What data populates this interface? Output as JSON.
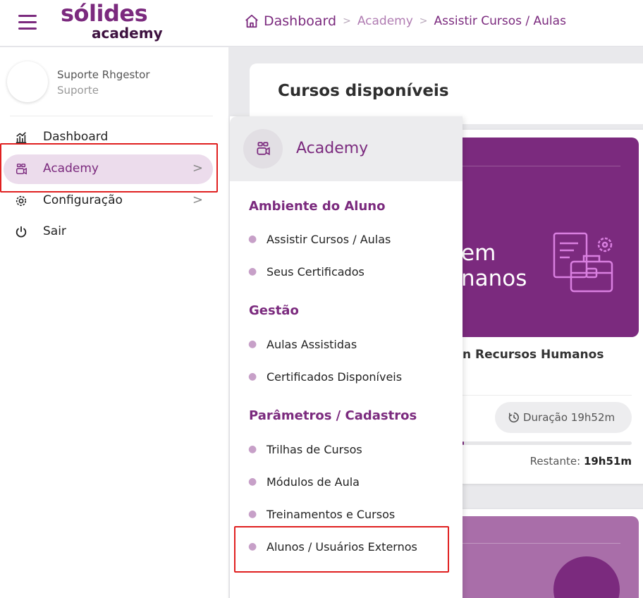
{
  "app": {
    "logo_main": "sólides",
    "logo_sub": "academy"
  },
  "breadcrumb": {
    "items": [
      "Dashboard",
      "Academy",
      "Assistir Cursos / Aulas"
    ]
  },
  "user": {
    "name": "Suporte Rhgestor",
    "role": "Suporte"
  },
  "sidebar": {
    "items": [
      {
        "label": "Dashboard",
        "icon": "chart-icon"
      },
      {
        "label": "Academy",
        "icon": "academy-icon",
        "active": true
      },
      {
        "label": "Configuração",
        "icon": "gear-icon"
      },
      {
        "label": "Sair",
        "icon": "power-icon"
      }
    ]
  },
  "submenu": {
    "title": "Academy",
    "sections": [
      {
        "title": "Ambiente do Aluno",
        "items": [
          "Assistir Cursos / Aulas",
          "Seus Certificados"
        ]
      },
      {
        "title": "Gestão",
        "items": [
          "Aulas Assistidas",
          "Certificados Disponíveis"
        ]
      },
      {
        "title": "Parâmetros / Cadastros",
        "items": [
          "Trilhas de Cursos",
          "Módulos de Aula",
          "Treinamentos e Cursos",
          "Alunos / Usuários Externos"
        ]
      }
    ]
  },
  "main": {
    "title": "Cursos disponíveis",
    "course": {
      "banner_line1": "em",
      "banner_line2": "nanos",
      "name": "n Recursos Humanos",
      "duration": "Duração 19h52m",
      "remaining_label": "Restante:",
      "remaining_value": "19h51m",
      "progress": 0.01
    }
  },
  "colors": {
    "brand": "#7b2a7e",
    "active_bg": "#ecdcec",
    "highlight": "#e02020"
  }
}
